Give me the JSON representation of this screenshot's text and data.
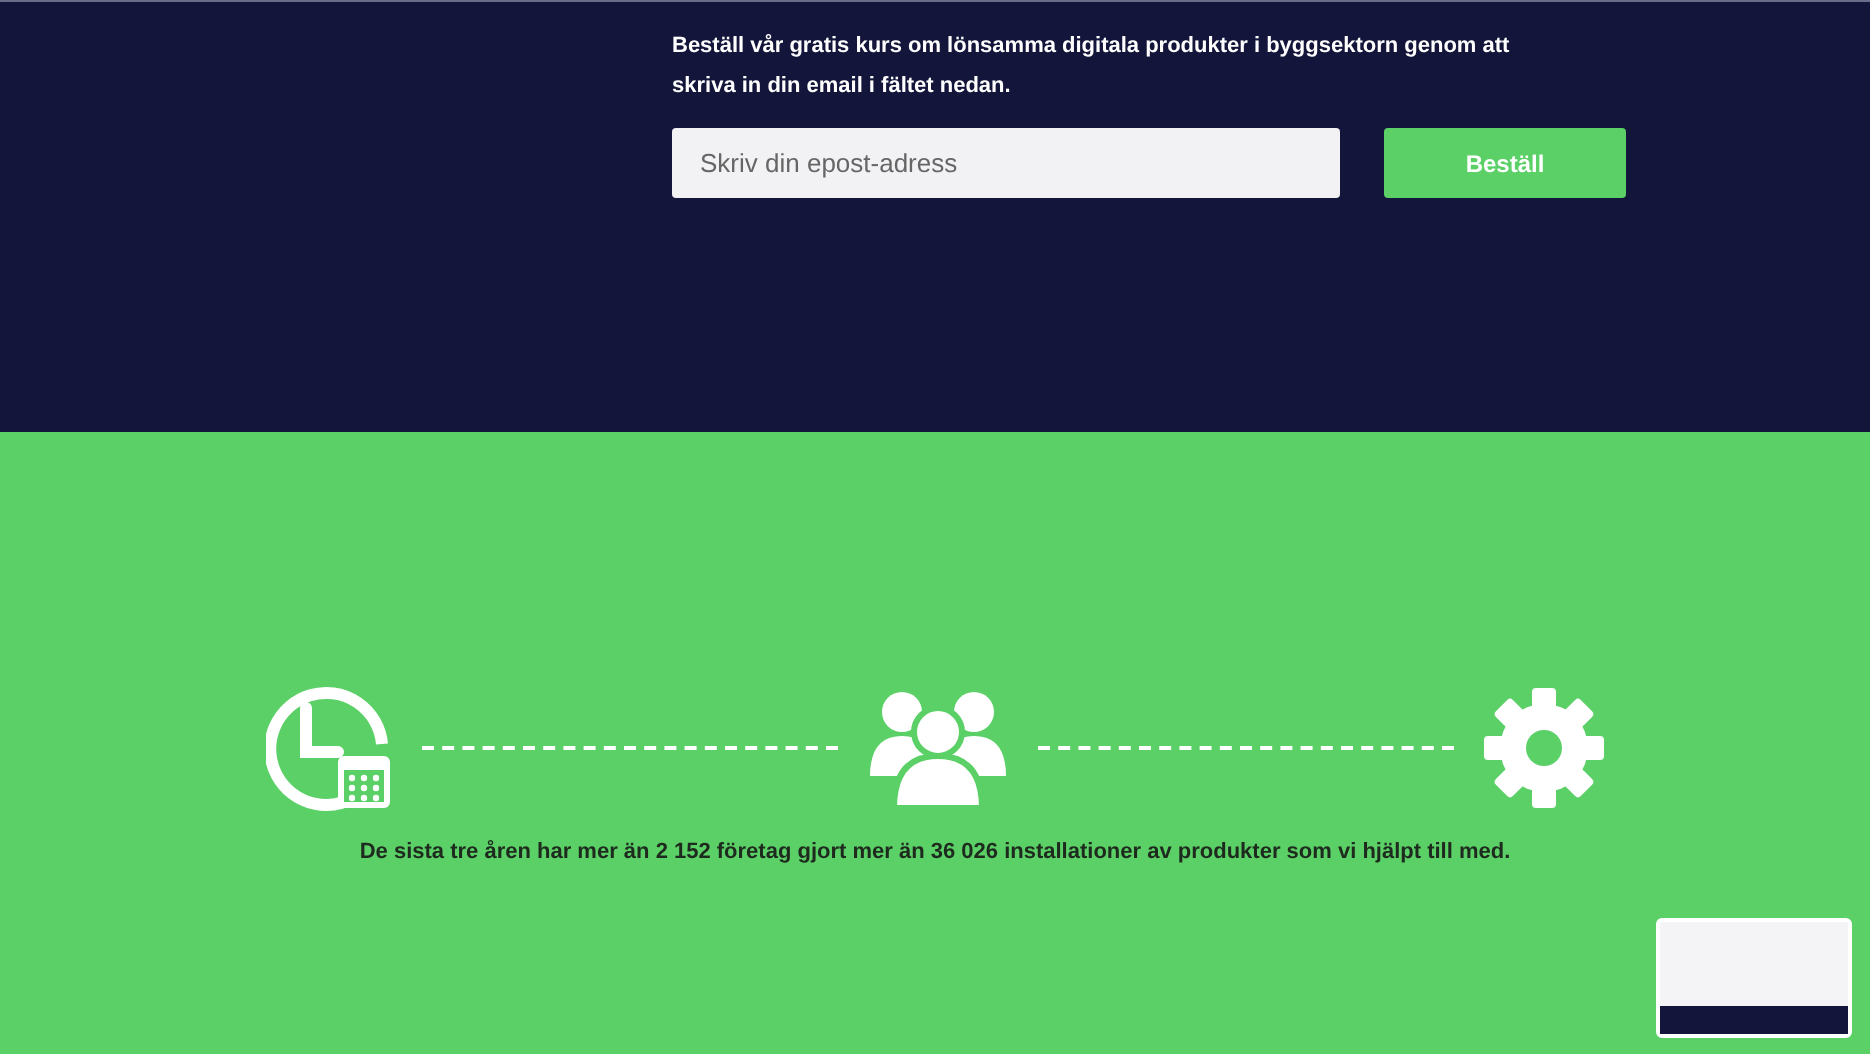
{
  "signup": {
    "intro": "Beställ vår gratis kurs om lönsamma digitala produkter i byggsektorn genom att skriva in din email i fältet nedan.",
    "email_field": {
      "placeholder": "Skriv din epost-adress"
    },
    "submit_button": "Beställ"
  },
  "stats": {
    "sentence": "De sista tre åren har mer än **2 152 företag** gjort mer än **36 026 installationer** av produkter som vi hjälpt till med."
  }
}
